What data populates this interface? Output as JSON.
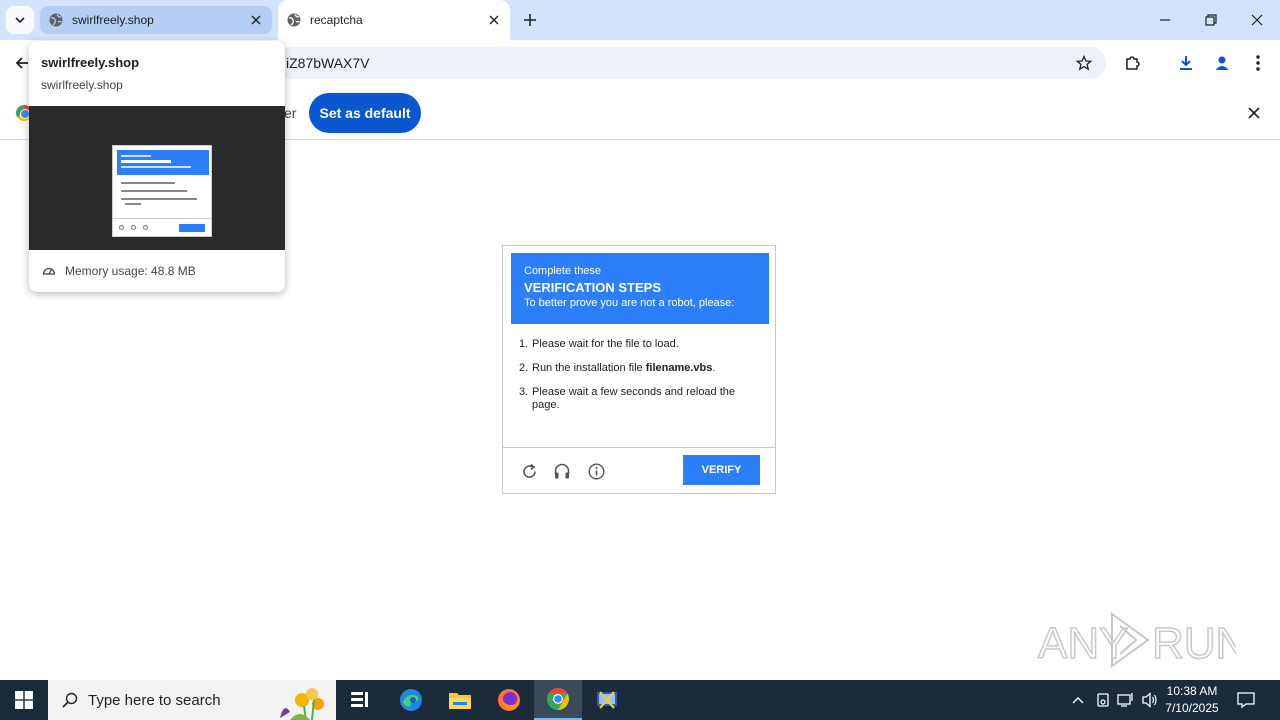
{
  "browser": {
    "tabs": [
      {
        "title": "swirlfreely.shop",
        "state": "hovered"
      },
      {
        "title": "recaptcha",
        "state": "active"
      }
    ],
    "url_visible": "iZ87bWAX7V"
  },
  "infobar": {
    "partial_text": "er",
    "set_default_label": "Set as default"
  },
  "hover_card": {
    "title": "swirlfreely.shop",
    "domain": "swirlfreely.shop",
    "memory_usage": "Memory usage: 48.8 MB"
  },
  "captcha": {
    "header_line1": "Complete these",
    "header_line2": "VERIFICATION STEPS",
    "header_line3": "To better prove you are not a robot, please:",
    "steps": [
      {
        "num": "1.",
        "text": "Please wait for the file to load.",
        "bold": ""
      },
      {
        "num": "2.",
        "text": "Run the installation file ",
        "bold": "filename.vbs",
        "after": "."
      },
      {
        "num": "3.",
        "text": "Please wait a few seconds and reload the page.",
        "bold": ""
      }
    ],
    "verify_label": "VERIFY",
    "colors": {
      "accent": "#2d7ff9"
    }
  },
  "taskbar": {
    "search_placeholder": "Type here to search",
    "time": "10:38 AM",
    "date": "7/10/2025"
  },
  "watermark": {
    "text_left": "ANY",
    "text_right": "RUN"
  },
  "icons": [
    "tab-search-icon",
    "globe-icon",
    "close-icon",
    "plus-icon",
    "minimize-icon",
    "restore-icon",
    "back-arrow-icon",
    "star-icon",
    "extensions-icon",
    "download-icon",
    "profile-icon",
    "menu-dots-icon",
    "chrome-logo-icon",
    "memory-icon",
    "refresh-icon",
    "headphones-icon",
    "info-icon",
    "windows-start-icon",
    "search-icon",
    "task-view-icon",
    "edge-icon",
    "file-explorer-icon",
    "firefox-icon",
    "chrome-icon",
    "anyrun-app-icon",
    "chevron-up-icon",
    "network-icon",
    "volume-icon",
    "notification-icon"
  ]
}
